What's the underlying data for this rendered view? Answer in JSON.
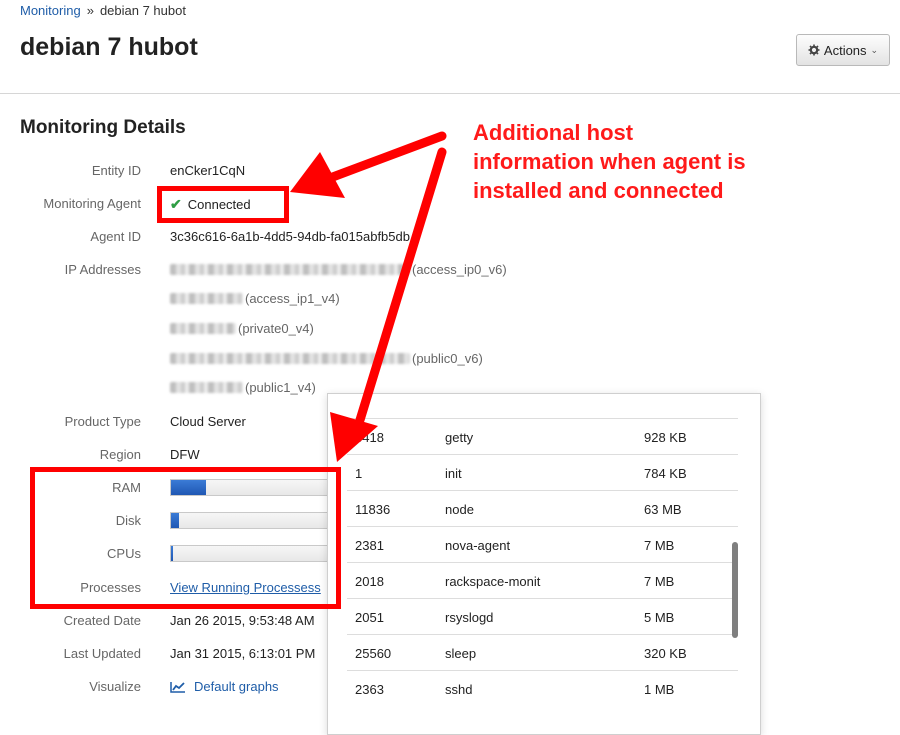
{
  "breadcrumb": {
    "parent": "Monitoring",
    "separator": "»",
    "current": "debian 7 hubot"
  },
  "page_title": "debian 7 hubot",
  "actions_label": "Actions",
  "section_title": "Monitoring Details",
  "details": {
    "entity_id": {
      "label": "Entity ID",
      "value": "enCker1CqN"
    },
    "monitoring_agent": {
      "label": "Monitoring Agent",
      "value": "Connected"
    },
    "agent_id": {
      "label": "Agent ID",
      "value": "3c36c616-6a1b-4dd5-94db-fa015abfb5db"
    },
    "ip_addresses": {
      "label": "IP Addresses",
      "entries": [
        {
          "suffix": "(access_ip0_v6)"
        },
        {
          "suffix": "(access_ip1_v4)"
        },
        {
          "suffix": "(private0_v4)"
        },
        {
          "suffix": "(public0_v6)"
        },
        {
          "suffix": "(public1_v4)"
        }
      ]
    },
    "product_type": {
      "label": "Product Type",
      "value": "Cloud Server"
    },
    "region": {
      "label": "Region",
      "value": "DFW"
    },
    "ram": {
      "label": "RAM",
      "usage_fraction": 0.21
    },
    "disk": {
      "label": "Disk",
      "usage_fraction": 0.05
    },
    "cpus": {
      "label": "CPUs",
      "usage_fraction": 0.01
    },
    "processes": {
      "label": "Processes",
      "link": "View Running Processess"
    },
    "created_date": {
      "label": "Created Date",
      "value": "Jan 26 2015, 9:53:48 AM"
    },
    "last_updated": {
      "label": "Last Updated",
      "value": "Jan 31 2015, 6:13:01 PM"
    },
    "visualize": {
      "label": "Visualize",
      "link": "Default graphs"
    }
  },
  "processes_popover": {
    "rows": [
      {
        "pid": "3418",
        "name": "getty",
        "memory": "928 KB"
      },
      {
        "pid": "1",
        "name": "init",
        "memory": "784 KB"
      },
      {
        "pid": "11836",
        "name": "node",
        "memory": "63 MB"
      },
      {
        "pid": "2381",
        "name": "nova-agent",
        "memory": "7 MB"
      },
      {
        "pid": "2018",
        "name": "rackspace-monit",
        "memory": "7 MB"
      },
      {
        "pid": "2051",
        "name": "rsyslogd",
        "memory": "5 MB"
      },
      {
        "pid": "25560",
        "name": "sleep",
        "memory": "320 KB"
      },
      {
        "pid": "2363",
        "name": "sshd",
        "memory": "1 MB"
      }
    ]
  },
  "annotation": {
    "lines": [
      "Additional host",
      "information when agent is",
      "installed and connected"
    ],
    "color": "#ff0000"
  },
  "colors": {
    "link": "#1f5da8",
    "bar_fill": "#1f57b3",
    "check": "#2f9e44"
  }
}
